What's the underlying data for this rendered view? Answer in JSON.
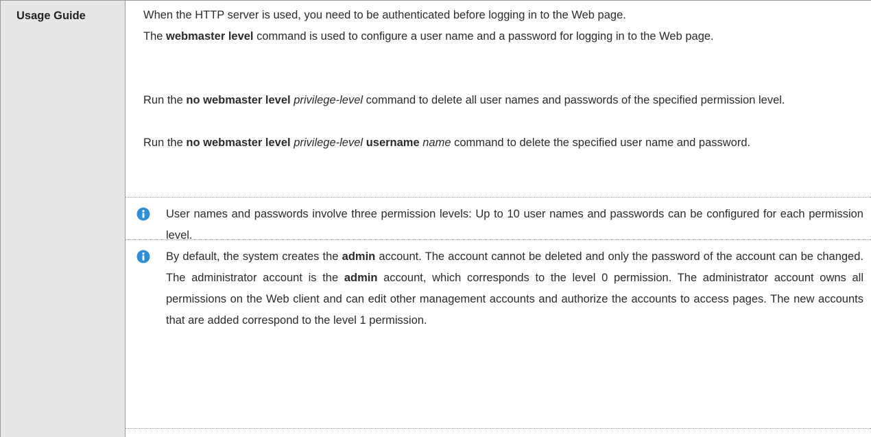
{
  "label": "Usage Guide",
  "p1": "When the HTTP server is used, you need to be authenticated before logging in to the Web page.",
  "p2": {
    "pre": "The ",
    "b1": "webmaster level",
    "post": " command is used to configure a user name and a password for logging in to the Web page."
  },
  "p3": {
    "pre": "Run the ",
    "b1": "no webmaster level",
    "i1": "privilege-level",
    "post": " command to delete all user names and passwords of the specified permission level."
  },
  "p4": {
    "pre": "Run the ",
    "b1": "no webmaster level",
    "i1": "privilege-level",
    "b2": "username",
    "i2": "name",
    "post": " command to delete the specified user name and password."
  },
  "note1": "User names and passwords involve three permission levels: Up to 10 user names and passwords can be configured for each permission level.",
  "note2": {
    "t1": "By default, the system creates the ",
    "b1": "admin",
    "t2": " account. The account cannot be deleted and only the password of the account can be changed. The administrator account is the ",
    "b2": "admin",
    "t3": " account, which corresponds to the level 0 permission. The administrator account owns all permissions on the Web client and can edit other management accounts and authorize the accounts to access pages. The new accounts that are added correspond to the level 1 permission."
  },
  "icons": {
    "note_icon": "info-icon",
    "note_icon_color": "#2e8fd6"
  }
}
